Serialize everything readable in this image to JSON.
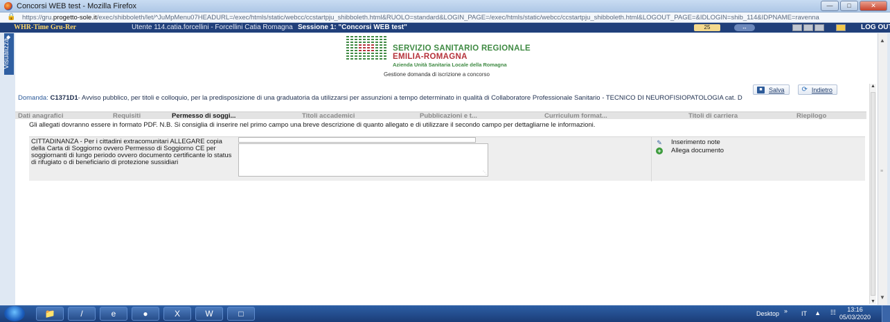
{
  "browser": {
    "window_title": "Concorsi WEB test - Mozilla Firefox",
    "url_prefix": "https://gru.",
    "url_domain": "progetto-sole.it",
    "url_rest": "/exec/shibboleth/let/^JuMpMenu07HEADURL=/exec/htmls/static/webcc/ccstartpju_shibboleth.html&RUOLO=standard&LOGIN_PAGE=/exec/htmls/static/webcc/ccstartpju_shibboleth.html&LOGOUT_PAGE=&IDLOGIN=shib_114&IDPNAME=ravenna"
  },
  "appbar": {
    "brand": "WHR-Time Gru-Rer",
    "user": "Utente 114.catia.forcellini - Forcellini Catia Romagna",
    "session": "Sessione 1: \"Concorsi WEB test\"",
    "badge": "25",
    "logout": "LOG OUT"
  },
  "side_tab": "Visualizza",
  "org": {
    "line1": "SERVIZIO SANITARIO REGIONALE",
    "line2": "EMILIA-ROMAGNA",
    "line3": "Azienda Unità Sanitaria Locale della Romagna",
    "subtitle": "Gestione domanda di iscrizione a concorso"
  },
  "buttons": {
    "save": "Salva",
    "back": "Indietro"
  },
  "domanda": {
    "label": "Domanda:",
    "code": "C1371D1",
    "text": "- Avviso pubblico, per titoli e colloquio, per la predisposizione di una graduatoria da utilizzarsi per assunzioni a tempo determinato in qualità di Collaboratore Professionale Sanitario - TECNICO DI NEUROFISIOPATOLOGIA cat. D"
  },
  "tabs": [
    {
      "label": "Dati anagrafici",
      "active": false
    },
    {
      "label": "Requisiti",
      "active": false
    },
    {
      "label": "Permesso di soggi...",
      "active": true
    },
    {
      "label": "Titoli accademici",
      "active": false
    },
    {
      "label": "Pubblicazioni e t...",
      "active": false
    },
    {
      "label": "Curriculum format...",
      "active": false
    },
    {
      "label": "Titoli di carriera",
      "active": false
    },
    {
      "label": "Riepilogo",
      "active": false
    }
  ],
  "info_text": "Gli allegati dovranno essere in formato PDF. N.B. Si consiglia di inserire nel primo campo una breve descrizione di quanto allegato e di utilizzare il secondo campo per dettagliarne le informazioni.",
  "panel": {
    "description": "CITTADINANZA - Per i cittadini extracomunitari ALLEGARE copia della Carta di Soggiorno ovvero Permesso di Soggiorno CE per soggiornanti di lungo periodo ovvero documento certificante lo status di rifugiato o di beneficiario di protezione sussidiari",
    "short_value": "",
    "long_value": "",
    "actions": [
      "Inserimento note",
      "Allega documento"
    ]
  },
  "taskbar": {
    "desktop": "Desktop",
    "lang": "IT",
    "time": "13:16",
    "date": "05/03/2020"
  }
}
